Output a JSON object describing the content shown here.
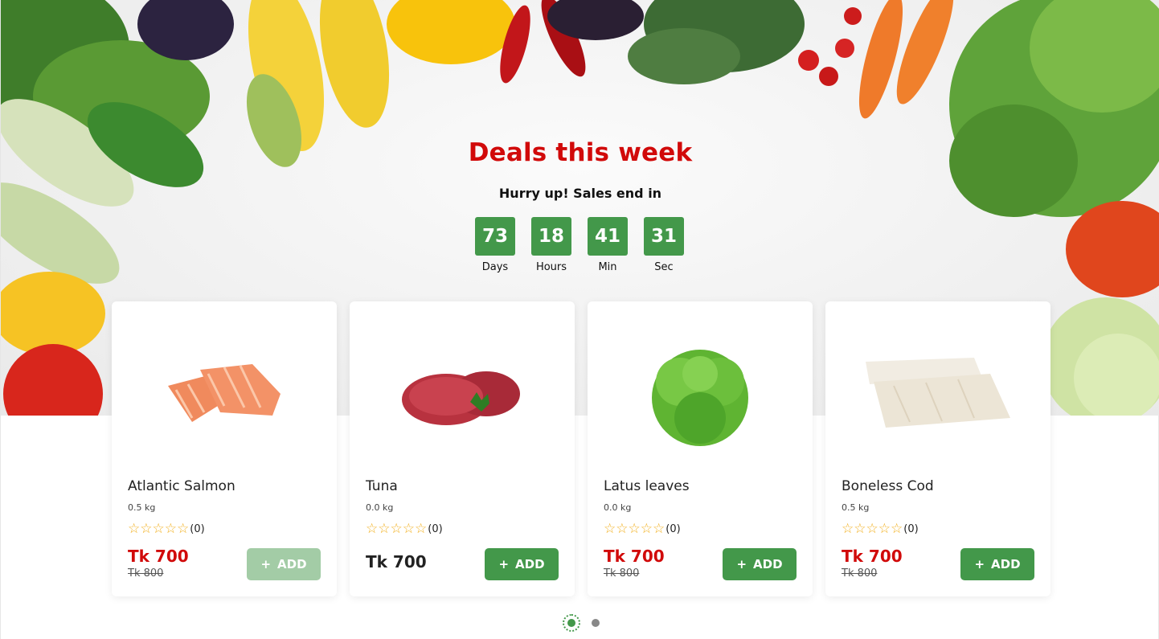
{
  "hero": {
    "title": "Deals this week",
    "subtitle": "Hurry up! Sales end in"
  },
  "countdown": [
    {
      "value": "73",
      "label": "Days"
    },
    {
      "value": "18",
      "label": "Hours"
    },
    {
      "value": "41",
      "label": "Min"
    },
    {
      "value": "31",
      "label": "Sec"
    }
  ],
  "products": [
    {
      "name": "Atlantic Salmon",
      "weight": "0.5 kg",
      "rating_count": "(0)",
      "price": "Tk 700",
      "old_price": "Tk 800",
      "add_label": "ADD",
      "image_icon": "salmon-fillet-image",
      "add_enabled": false
    },
    {
      "name": "Tuna",
      "weight": "0.0 kg",
      "rating_count": "(0)",
      "price": "Tk 700",
      "old_price": "",
      "add_label": "ADD",
      "image_icon": "tuna-steak-image",
      "add_enabled": true
    },
    {
      "name": "Latus leaves",
      "weight": "0.0 kg",
      "rating_count": "(0)",
      "price": "Tk 700",
      "old_price": "Tk 800",
      "add_label": "ADD",
      "image_icon": "lettuce-image",
      "add_enabled": true
    },
    {
      "name": "Boneless Cod",
      "weight": "0.5 kg",
      "rating_count": "(0)",
      "price": "Tk 700",
      "old_price": "Tk 800",
      "add_label": "ADD",
      "image_icon": "cod-fillet-image",
      "add_enabled": true
    }
  ],
  "pagination": {
    "pages": 2,
    "active": 1
  },
  "colors": {
    "accent": "#43984a",
    "sale": "#d10a0a",
    "star": "#f2b01e"
  }
}
